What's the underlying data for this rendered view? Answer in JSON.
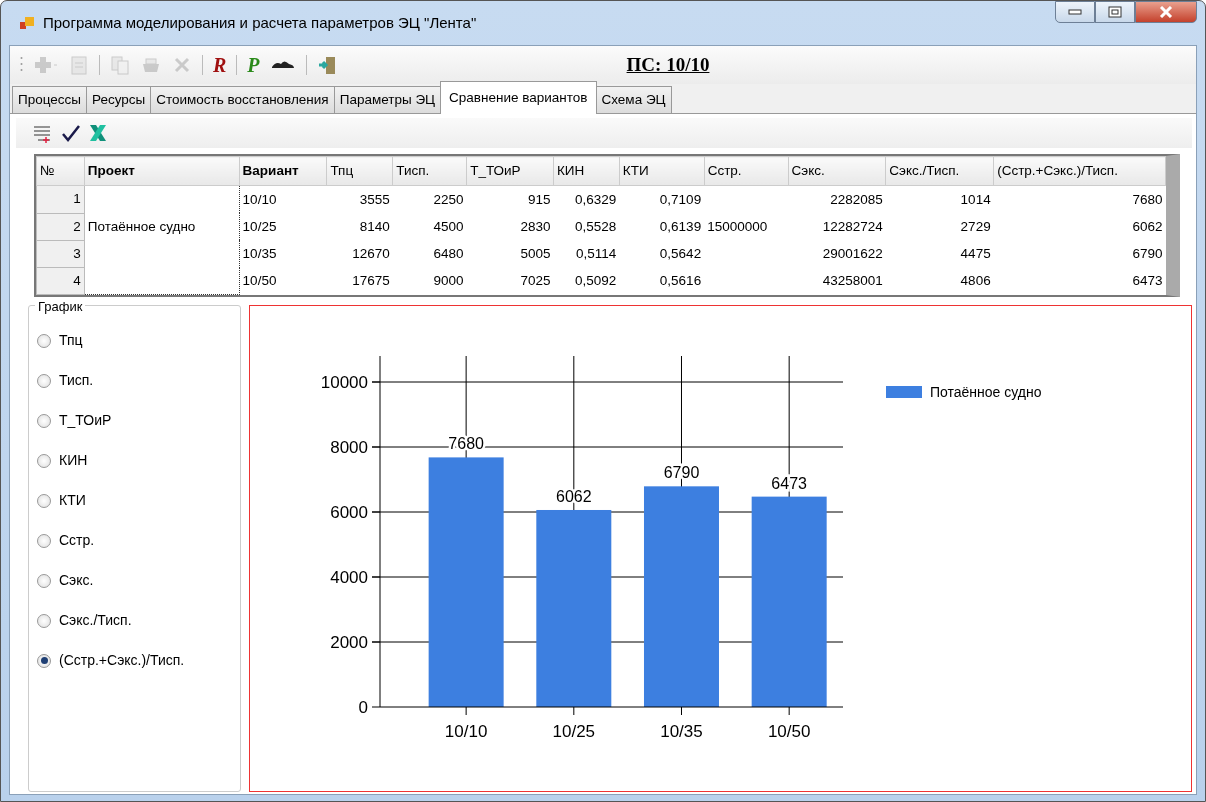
{
  "window": {
    "title": "Программа моделирования и расчета параметров ЭЦ \"Лента\""
  },
  "toolbar": [
    {
      "kind": "add",
      "disabled": true
    },
    {
      "kind": "document",
      "disabled": true
    },
    {
      "kind": "copy",
      "disabled": true
    },
    {
      "kind": "print",
      "disabled": true
    },
    {
      "kind": "delete",
      "disabled": true
    },
    {
      "kind": "letter",
      "label": "R",
      "color": "#a01010",
      "disabled": false
    },
    {
      "kind": "letter",
      "label": "P",
      "color": "#2a8a1a",
      "disabled": false
    },
    {
      "kind": "cloud",
      "disabled": false
    },
    {
      "kind": "exit",
      "disabled": false
    }
  ],
  "status_label": "ПС: 10/10",
  "tabs": [
    {
      "label": "Процессы",
      "selected": false
    },
    {
      "label": "Ресурсы",
      "selected": false
    },
    {
      "label": "Стоимость восстановления",
      "selected": false
    },
    {
      "label": "Параметры ЭЦ",
      "selected": false
    },
    {
      "label": "Сравнение вариантов",
      "selected": true
    },
    {
      "label": "Схема ЭЦ",
      "selected": false
    }
  ],
  "sub_toolbar": [
    {
      "kind": "list-add"
    },
    {
      "kind": "check"
    },
    {
      "kind": "excel"
    }
  ],
  "table": {
    "columns": [
      "№",
      "Проект",
      "Вариант",
      "Тпц",
      "Тисп.",
      "Т_ТОиР",
      "КИН",
      "КТИ",
      "Сстр.",
      "Сэкс.",
      "Сэкс./Тисп.",
      "(Сстр.+Сэкс.)/Тисп."
    ],
    "rows": [
      {
        "cells": [
          "1",
          "",
          "10/10",
          "3555",
          "2250",
          "915",
          "0,6329",
          "0,7109",
          "",
          "2282085",
          "1014",
          "7680"
        ]
      },
      {
        "cells": [
          "2",
          "Потаённое судно",
          "10/25",
          "8140",
          "4500",
          "2830",
          "0,5528",
          "0,6139",
          "15000000",
          "12282724",
          "2729",
          "6062"
        ]
      },
      {
        "cells": [
          "3",
          "",
          "10/35",
          "12670",
          "6480",
          "5005",
          "0,5114",
          "0,5642",
          "",
          "29001622",
          "4475",
          "6790"
        ]
      },
      {
        "cells": [
          "4",
          "",
          "10/50",
          "17675",
          "9000",
          "7025",
          "0,5092",
          "0,5616",
          "",
          "43258001",
          "4806",
          "6473"
        ]
      }
    ]
  },
  "graph_group": {
    "title": "График",
    "options": [
      {
        "label": "Тпц",
        "selected": false
      },
      {
        "label": "Тисп.",
        "selected": false
      },
      {
        "label": "Т_ТОиР",
        "selected": false
      },
      {
        "label": "КИН",
        "selected": false
      },
      {
        "label": "КТИ",
        "selected": false
      },
      {
        "label": "Сстр.",
        "selected": false
      },
      {
        "label": "Сэкс.",
        "selected": false
      },
      {
        "label": "Сэкс./Тисп.",
        "selected": false
      },
      {
        "label": "(Сстр.+Сэкс.)/Тисп.",
        "selected": true
      }
    ]
  },
  "chart": {
    "chart_data": {
      "type": "bar",
      "categories": [
        "10/10",
        "10/25",
        "10/35",
        "10/50"
      ],
      "series": [
        {
          "name": "Потаённое судно",
          "color": "#3d7fe0",
          "values": [
            7680,
            6062,
            6790,
            6473
          ]
        }
      ],
      "ylim": [
        0,
        10800
      ],
      "grid": true,
      "yticks": [
        0,
        2000,
        4000,
        6000,
        8000,
        10000
      ],
      "data_labels": true
    }
  }
}
